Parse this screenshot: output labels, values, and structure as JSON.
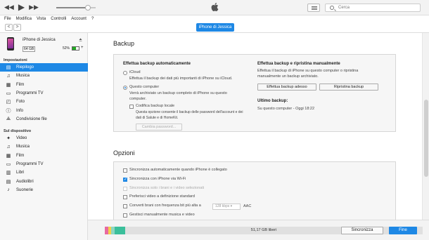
{
  "player": {
    "volume_fraction": 0.8,
    "search_placeholder": "Cerca",
    "icons": [
      "rewind-icon",
      "play-icon",
      "fast-forward-icon",
      "apple-logo",
      "list-view-icon",
      "search-icon"
    ]
  },
  "menu": [
    "File",
    "Modifica",
    "Vista",
    "Controlli",
    "Account",
    "?"
  ],
  "nav": {
    "back": "<",
    "forward": ">",
    "device_pill": "iPhone di Jessica"
  },
  "device": {
    "name": "iPhone di Jessica",
    "capacity": "64 GB",
    "battery_pct": "52%",
    "battery_fraction": 0.52,
    "charging": "+"
  },
  "sidebar": {
    "settings_title": "Impostazioni",
    "settings_items": [
      {
        "label": "Riepilogo",
        "icon": "summary-icon",
        "active": true
      },
      {
        "label": "Musica",
        "icon": "music-icon"
      },
      {
        "label": "Film",
        "icon": "film-icon"
      },
      {
        "label": "Programmi TV",
        "icon": "tv-icon"
      },
      {
        "label": "Foto",
        "icon": "photo-icon"
      },
      {
        "label": "Info",
        "icon": "info-icon"
      },
      {
        "label": "Condivisione file",
        "icon": "file-sharing-icon"
      }
    ],
    "device_title": "Sul dispositivo",
    "device_items": [
      {
        "label": "Video",
        "icon": "video-icon"
      },
      {
        "label": "Musica",
        "icon": "music-icon"
      },
      {
        "label": "Film",
        "icon": "film-icon"
      },
      {
        "label": "Programmi TV",
        "icon": "tv-icon"
      },
      {
        "label": "Libri",
        "icon": "books-icon"
      },
      {
        "label": "Audiolibri",
        "icon": "audiobooks-icon"
      },
      {
        "label": "Suonerie",
        "icon": "ringtones-icon"
      }
    ]
  },
  "backup": {
    "title": "Backup",
    "auto_title": "Effettua backup automaticamente",
    "icloud_label": "iCloud",
    "icloud_desc": "Effettua il backup dei dati più importanti di iPhone su iCloud.",
    "computer_label": "Questo computer",
    "computer_desc_1": "Verrà archiviato un backup completo di iPhone su questo",
    "computer_desc_2": "computer.",
    "encrypt_label": "Codifica backup locale",
    "encrypt_desc_1": "Questa opzione consente il backup delle password dell'account e dei",
    "encrypt_desc_2": "dati di Salute e di HomeKit.",
    "change_password": "Cambia password...",
    "manual_title": "Effettua backup e ripristina manualmente",
    "manual_desc_1": "Effettua il backup di iPhone su questo computer o ripristina",
    "manual_desc_2": "manualmente un backup archiviato.",
    "backup_now": "Effettua backup adesso",
    "restore": "Ripristina backup",
    "last_title": "Ultimo backup:",
    "last_value": "Su questo computer - Oggi 18:22"
  },
  "options": {
    "title": "Opzioni",
    "items": [
      {
        "label": "Sincronizza automaticamente quando iPhone è collegato",
        "checked": false,
        "disabled": false
      },
      {
        "label": "Sincronizza con iPhone via Wi-Fi",
        "checked": true,
        "disabled": false
      },
      {
        "label": "Sincronizza solo i brani e i video selezionati",
        "checked": false,
        "disabled": true
      },
      {
        "label": "Preferisci video a definizione standard",
        "checked": false,
        "disabled": false
      },
      {
        "label": "Converti brani con frequenza bit più alta a",
        "checked": false,
        "disabled": false
      },
      {
        "label": "Gestisci manualmente musica e video",
        "checked": false,
        "disabled": false
      }
    ],
    "bitrate_value": "128 kbps",
    "bitrate_suffix": "AAC"
  },
  "footer": {
    "free_space": "51,17 GB liberi",
    "sync_button": "Sincronizza",
    "done_button": "Fine",
    "storage_segments": [
      {
        "color": "#e86aa0",
        "fraction": 0.012
      },
      {
        "color": "#f2d24a",
        "fraction": 0.008
      },
      {
        "color": "#8fd6c2",
        "fraction": 0.01
      },
      {
        "color": "#3bbf9b",
        "fraction": 0.035
      }
    ]
  },
  "colors": {
    "accent": "#1e88e5"
  }
}
